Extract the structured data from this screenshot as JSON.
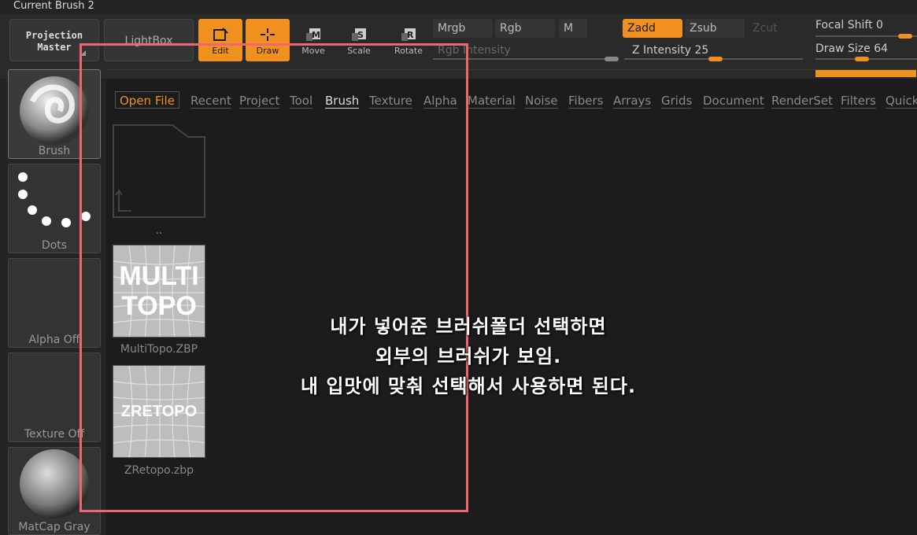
{
  "window": {
    "title": "Current Brush 2"
  },
  "toolbar": {
    "projection_master": [
      "Projection",
      "Master"
    ],
    "lightbox": "LightBox",
    "tools": [
      {
        "label": "Edit",
        "active": true
      },
      {
        "label": "Draw",
        "active": true
      },
      {
        "label": "Move",
        "key": "M",
        "active": false
      },
      {
        "label": "Scale",
        "key": "S",
        "active": false
      },
      {
        "label": "Rotate",
        "key": "R",
        "active": false
      }
    ],
    "color_mode": {
      "mrgb": "Mrgb",
      "rgb": "Rgb",
      "m": "M"
    },
    "rgb_intensity": "Rgb Intensity",
    "z_mode": {
      "zadd": "Zadd",
      "zsub": "Zsub",
      "zcut": "Zcut"
    },
    "z_intensity": {
      "label": "Z Intensity",
      "value": "25"
    },
    "focal_shift": {
      "label": "Focal Shift",
      "value": "0"
    },
    "draw_size": {
      "label": "Draw Size",
      "value": "64"
    },
    "accent_color": "#f0901e"
  },
  "sidebar": {
    "items": [
      {
        "label": "Brush",
        "icon": "brush-sphere-icon"
      },
      {
        "label": "Dots",
        "icon": "dots-stroke-icon"
      },
      {
        "label": "Alpha Off",
        "icon": "empty-alpha-icon"
      },
      {
        "label": "Texture Off",
        "icon": "empty-texture-icon"
      },
      {
        "label": "MatCap Gray",
        "icon": "matcap-sphere-icon"
      }
    ]
  },
  "browser": {
    "tabs": [
      "Open File",
      "Recent",
      "Project",
      "Tool",
      "Brush",
      "Texture",
      "Alpha",
      "Material",
      "Noise",
      "Fibers",
      "Arrays",
      "Grids",
      "Document",
      "RenderSet",
      "Filters",
      "Quick"
    ],
    "active_tab": "Brush",
    "parent_folder_label": "..",
    "files": [
      {
        "name": "MultiTopo.ZBP",
        "thumb_lines": [
          "MULTI",
          "TOPO"
        ]
      },
      {
        "name": "ZRetopo.zbp",
        "thumb_lines": [
          "ZRETOPO"
        ]
      }
    ]
  },
  "annotation": {
    "lines": [
      "내가 넣어준 브러쉬폴더 선택하면",
      "외부의 브러쉬가 보임.",
      "내 입맛에 맞춰 선택해서 사용하면 된다."
    ],
    "frame_color": "#f06670"
  }
}
